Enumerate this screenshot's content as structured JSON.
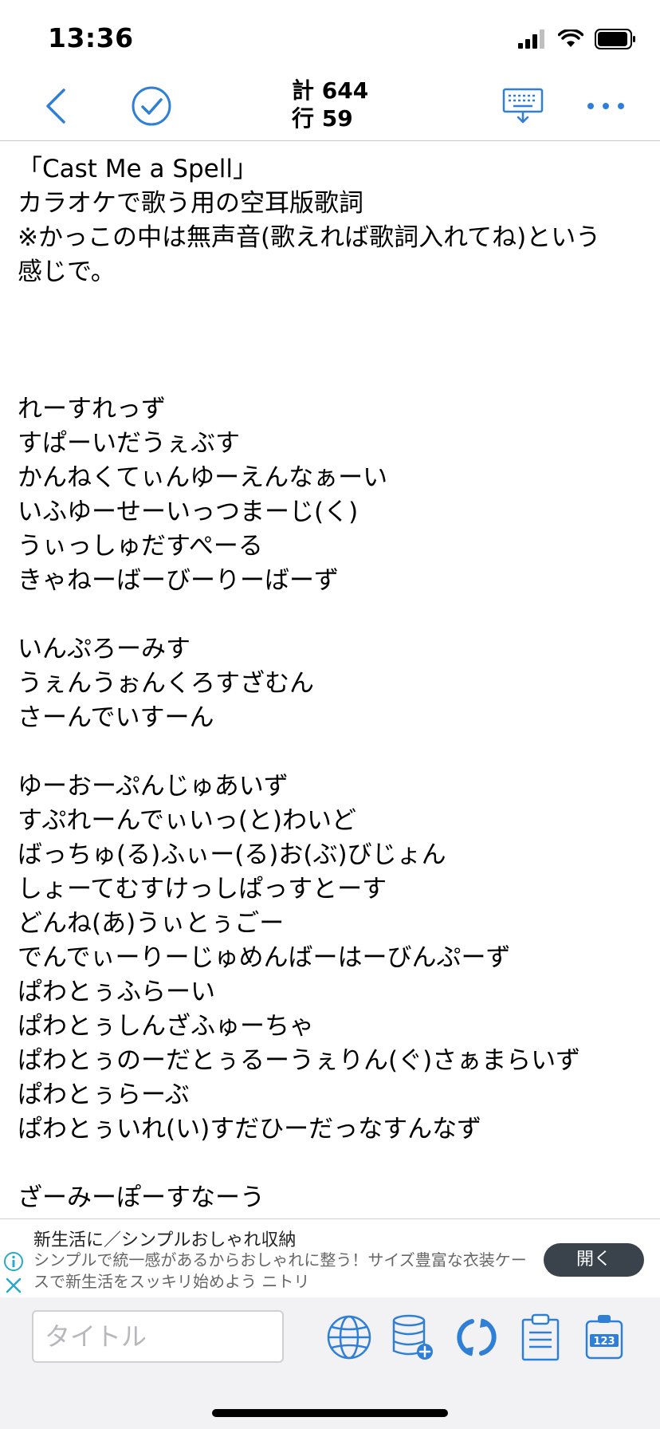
{
  "status": {
    "time": "13:36"
  },
  "nav": {
    "back_icon": "chevron-left-icon",
    "check_icon": "check-circle-icon",
    "count_total": "計 644",
    "count_lines": "行 59",
    "keyboard_icon": "keyboard-hide-icon",
    "more_icon": "more-icon"
  },
  "editor": {
    "lines": [
      "「Cast Me a Spell」",
      "カラオケで歌う用の空耳版歌詞",
      "※かっこの中は無声音(歌えれば歌詞入れてね)という",
      "感じで。",
      "",
      "",
      "",
      "れーすれっず",
      "すぱーいだうぇぶす",
      "かんねくてぃんゆーえんなぁーい",
      "いふゆーせーいっつまーじ(く)",
      "うぃっしゅだすぺーる",
      "きゃねーばーびーりーばーず",
      "",
      "いんぷろーみす",
      "うぇんうぉんくろすざむん",
      "さーんでいすーん",
      "",
      "ゆーおーぷんじゅあいず",
      "すぷれーんでぃいっ(と)わいど",
      "ばっちゅ(る)ふぃー(る)お(ぶ)びじょん",
      "しょーてむすけっしぱっすとーす",
      "どんね(あ)うぃとぅごー",
      "でんでぃーりーじゅめんばーはーびんぷーず",
      "ぱわとぅふらーい",
      "ぱわとぅしんざふゅーちゃ",
      "ぱわとぅのーだとぅるーうぇりん(ぐ)さぁまらいず",
      "ぱわとぅらーぶ",
      "ぱわとぅいれ(い)すだひーだっなすんなず",
      "",
      "ざーみーぽーすなーう"
    ]
  },
  "ad": {
    "title": "新生活に／シンプルおしゃれ収納",
    "description": "シンプルで統一感があるからおしゃれに整う！サイズ豊富な衣装ケースで新生活をスッキリ始めよう ニトリ",
    "open_label": "開く"
  },
  "toolbar": {
    "title_placeholder": "タイトル",
    "title_value": "",
    "tools": [
      "globe-icon",
      "database-add-icon",
      "sync-icon",
      "clipboard-icon",
      "counter-123-icon"
    ],
    "counter_label": "123"
  },
  "colors": {
    "accent": "#2f7fd6",
    "ad_button": "#3a434c"
  }
}
